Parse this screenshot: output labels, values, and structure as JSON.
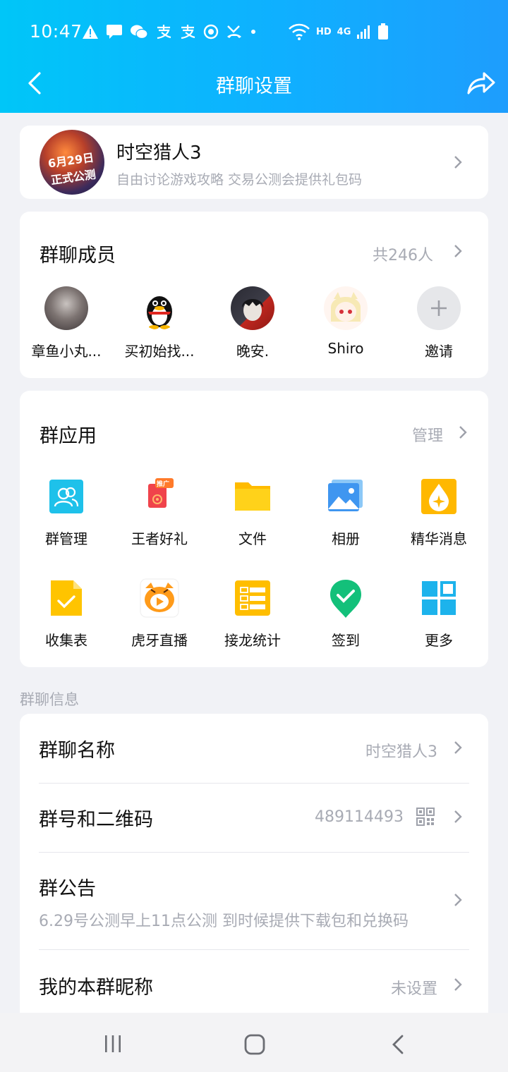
{
  "status_bar": {
    "time": "10:47",
    "network": "4G",
    "hd": "HD"
  },
  "header": {
    "title": "群聊设置"
  },
  "group": {
    "name": "时空猎人3",
    "description": "自由讨论游戏攻略 交易公测会提供礼包码",
    "avatar_text": "6月29日 正式公测"
  },
  "members": {
    "title": "群聊成员",
    "count": "共246人",
    "items": [
      {
        "name": "章鱼小丸..."
      },
      {
        "name": "买初始找..."
      },
      {
        "name": "晚安."
      },
      {
        "name": "Shiro"
      },
      {
        "name": "邀请"
      }
    ]
  },
  "apps": {
    "title": "群应用",
    "manage": "管理",
    "badge": "推广",
    "items": [
      {
        "name": "群管理",
        "icon": "group-manage-icon"
      },
      {
        "name": "王者好礼",
        "icon": "king-gift-icon"
      },
      {
        "name": "文件",
        "icon": "folder-icon"
      },
      {
        "name": "相册",
        "icon": "album-icon"
      },
      {
        "name": "精华消息",
        "icon": "essence-icon"
      },
      {
        "name": "收集表",
        "icon": "collect-form-icon"
      },
      {
        "name": "虎牙直播",
        "icon": "huya-live-icon"
      },
      {
        "name": "接龙统计",
        "icon": "relay-stats-icon"
      },
      {
        "name": "签到",
        "icon": "checkin-icon"
      },
      {
        "name": "更多",
        "icon": "more-grid-icon"
      }
    ]
  },
  "info": {
    "section_label": "群聊信息",
    "name_label": "群聊名称",
    "name_value": "时空猎人3",
    "number_label": "群号和二维码",
    "number_value": "489114493",
    "notice_label": "群公告",
    "notice_value": "6.29号公测早上11点公测 到时候提供下载包和兑换码",
    "nickname_label": "我的本群昵称",
    "nickname_value": "未设置"
  },
  "colors": {
    "header_start": "#00c6f8",
    "header_end": "#1e9dfd",
    "secondary_text": "#a8abb4"
  }
}
